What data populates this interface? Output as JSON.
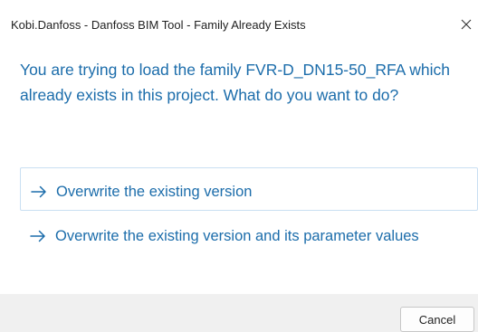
{
  "window": {
    "title": "Kobi.Danfoss - Danfoss BIM Tool - Family Already Exists",
    "close_icon": "close-icon"
  },
  "content": {
    "main_instruction": "You are trying to load the family FVR-D_DN15-50_RFA which already exists in this project. What do you want to do?",
    "command_links": [
      {
        "icon": "arrow-right-icon",
        "label": "Overwrite the existing version"
      },
      {
        "icon": "arrow-right-icon",
        "label": "Overwrite the existing version and its parameter values"
      }
    ]
  },
  "footer": {
    "cancel_label": "Cancel"
  },
  "colors": {
    "accent": "#1c6dab",
    "footer_bg": "#f0f0f0",
    "link_hover_border": "#c9dff2"
  }
}
